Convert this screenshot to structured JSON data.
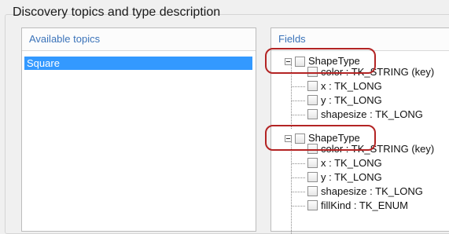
{
  "group_title": "Discovery topics and type description",
  "topics": {
    "header": "Available topics",
    "items": [
      "Square"
    ],
    "selected": "Square"
  },
  "fields": {
    "header": "Fields",
    "types": [
      {
        "name": "ShapeType",
        "fields": [
          "color : TK_STRING (key)",
          "x : TK_LONG",
          "y : TK_LONG",
          "shapesize : TK_LONG"
        ]
      },
      {
        "name": "ShapeType",
        "fields": [
          "color : TK_STRING (key)",
          "x : TK_LONG",
          "y : TK_LONG",
          "shapesize : TK_LONG",
          "fillKind : TK_ENUM"
        ]
      }
    ]
  },
  "colors": {
    "selection": "#3399ff",
    "header_text": "#3b73b9",
    "highlight": "#b32424"
  }
}
